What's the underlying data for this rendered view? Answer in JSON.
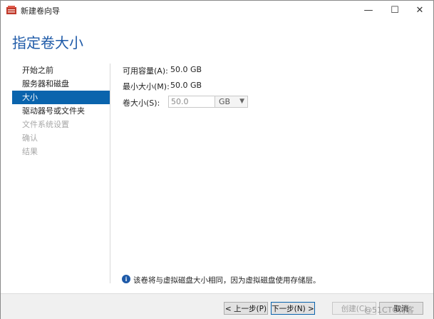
{
  "window": {
    "title": "新建卷向导",
    "controls": {
      "minimize": "—",
      "maximize": "☐",
      "close": "✕"
    }
  },
  "page_title": "指定卷大小",
  "nav": {
    "items": [
      {
        "label": "开始之前",
        "state": "normal"
      },
      {
        "label": "服务器和磁盘",
        "state": "normal"
      },
      {
        "label": "大小",
        "state": "selected"
      },
      {
        "label": "驱动器号或文件夹",
        "state": "normal"
      },
      {
        "label": "文件系统设置",
        "state": "disabled"
      },
      {
        "label": "确认",
        "state": "disabled"
      },
      {
        "label": "结果",
        "state": "disabled"
      }
    ]
  },
  "form": {
    "available_label": "可用容量(A):",
    "available_value": "50.0 GB",
    "min_label": "最小大小(M):",
    "min_value": "50.0 GB",
    "size_label": "卷大小(S):",
    "size_value": "50.0",
    "unit_value": "GB"
  },
  "info": {
    "icon": "info-icon",
    "text": "该卷将与虚拟磁盘大小相同，因为虚拟磁盘使用存储层。"
  },
  "buttons": {
    "prev": "< 上一步(P)",
    "next": "下一步(N) >",
    "create": "创建(C)",
    "cancel": "取消"
  },
  "watermark": "@51CTO博客",
  "colors": {
    "accent": "#0a64ad",
    "title": "#1e5aa8"
  }
}
